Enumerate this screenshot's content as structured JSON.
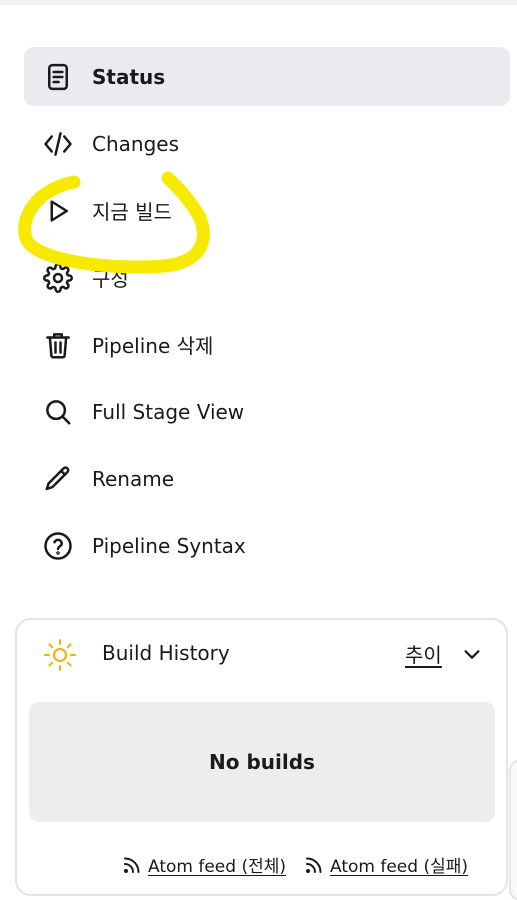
{
  "sidebar": {
    "items": [
      {
        "label": "Status",
        "icon": "document-icon",
        "active": true
      },
      {
        "label": "Changes",
        "icon": "code-icon",
        "active": false
      },
      {
        "label": "지금 빌드",
        "icon": "play-icon",
        "active": false
      },
      {
        "label": "구성",
        "icon": "gear-icon",
        "active": false
      },
      {
        "label": "Pipeline 삭제",
        "icon": "trash-icon",
        "active": false
      },
      {
        "label": "Full Stage View",
        "icon": "search-icon",
        "active": false
      },
      {
        "label": "Rename",
        "icon": "pencil-icon",
        "active": false
      },
      {
        "label": "Pipeline Syntax",
        "icon": "help-icon",
        "active": false
      }
    ]
  },
  "annotation": {
    "color": "#f7ea00"
  },
  "build_history": {
    "title": "Build History",
    "trend_link": "추이",
    "empty_text": "No builds",
    "sun_color": "#f0b400",
    "feeds": [
      {
        "label": "Atom feed (전체)",
        "icon": "rss-icon"
      },
      {
        "label": "Atom feed (실패)",
        "icon": "rss-icon"
      }
    ]
  },
  "colors": {
    "active_bg": "#eaeaef",
    "panel_border": "#e3e3ea",
    "empty_bg": "#ededf0"
  }
}
